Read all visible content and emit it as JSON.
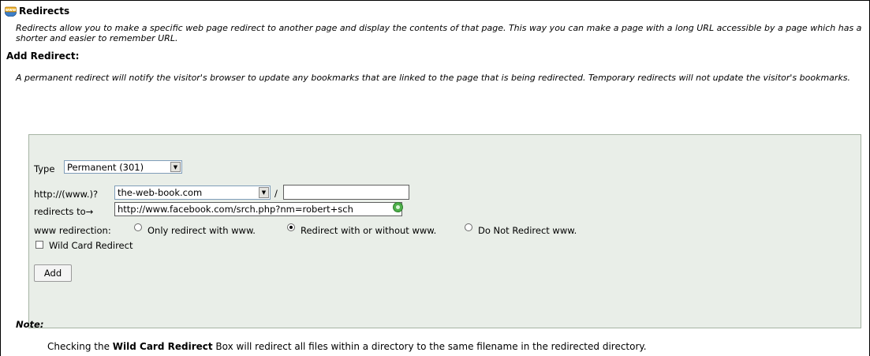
{
  "header": {
    "icon": "www-globe-icon",
    "title": "Redirects",
    "description": "Redirects allow you to make a specific web page redirect to another page and display the contents of that page. This way you can make a page with a long URL accessible by a page which has a shorter and easier to remember URL."
  },
  "add_redirect": {
    "heading": "Add Redirect:",
    "description": "A permanent redirect will notify the visitor's browser to update any bookmarks that are linked to the page that is being redirected. Temporary redirects will not update the visitor's bookmarks."
  },
  "form": {
    "type_label": "Type",
    "type_value": "Permanent (301)",
    "http_label": "http://(www.)?",
    "domain_value": "the-web-book.com",
    "slash": "/",
    "path_value": "",
    "redirects_to_label": "redirects to→",
    "redirects_to_value": "http://www.facebook.com/srch.php?nm=robert+sch",
    "www_label": "www redirection:",
    "www_options": [
      {
        "label": "Only redirect with www.",
        "selected": false
      },
      {
        "label": "Redirect with or without www.",
        "selected": true
      },
      {
        "label": "Do Not Redirect www.",
        "selected": false
      }
    ],
    "wildcard_label": "Wild Card Redirect",
    "wildcard_checked": false,
    "add_button": "Add"
  },
  "note": {
    "heading": "Note:",
    "text_before": "Checking the ",
    "text_bold": "Wild Card Redirect",
    "text_after": " Box will redirect all files within a directory to the same filename in the redirected directory."
  },
  "colors": {
    "panel_bg": "#e9eee8",
    "panel_border": "#a6b4a4"
  }
}
